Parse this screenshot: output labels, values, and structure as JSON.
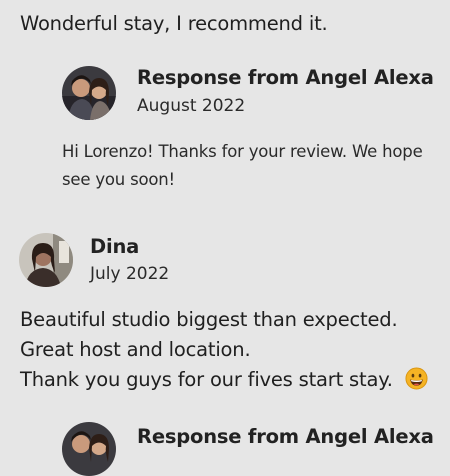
{
  "reviews": [
    {
      "text_lines": [
        "Wonderful stay, I recommend it."
      ],
      "response": {
        "title": "Response from Angel Alexa",
        "date": "August 2022",
        "text_lines": [
          "Hi Lorenzo! Thanks for your review. We hope",
          "see you soon!"
        ]
      }
    },
    {
      "reviewer": "Dina",
      "date": "July 2022",
      "text_lines": [
        "Beautiful studio biggest than expected.",
        "Great host and location.",
        "Thank you guys for our fives start stay."
      ],
      "emoji": "grinning-face-icon",
      "response": {
        "title": "Response from Angel Alexa"
      }
    }
  ],
  "colors": {
    "background": "#e6e6e6",
    "text": "#222222",
    "emoji": "#f5b324"
  }
}
